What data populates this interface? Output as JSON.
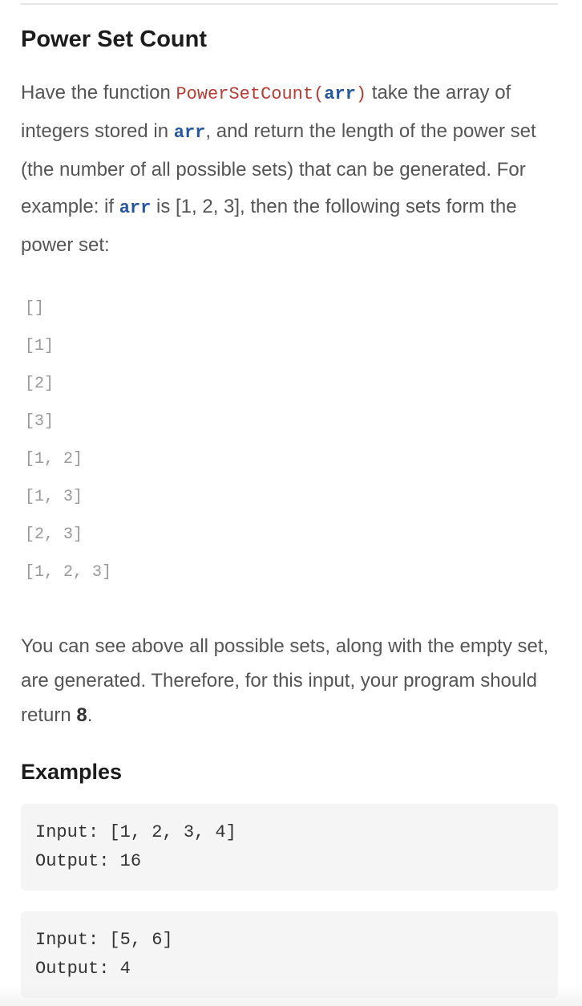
{
  "title": "Power Set Count",
  "intro": {
    "t1": "Have the function ",
    "fn_name": "PowerSetCount(",
    "fn_arg": "arr",
    "fn_close": ")",
    "t2": " take the array of integers stored in ",
    "arr1": "arr",
    "t3": ", and return the length of the power set (the number of all possible sets) that can be generated. For example: if ",
    "arr2": "arr",
    "t4": " is [1, 2, 3], then the following sets form the power set:"
  },
  "sets": [
    "[]",
    "[1]",
    "[2]",
    "[3]",
    "[1, 2]",
    "[1, 3]",
    "[2, 3]",
    "[1, 2, 3]"
  ],
  "outro": {
    "t1": "You can see above all possible sets, along with the empty set, are generated. Therefore, for this input, your program should return ",
    "answer": "8",
    "t2": "."
  },
  "examples_title": "Examples",
  "examples": [
    {
      "input": "Input: [1, 2, 3, 4]",
      "output": "Output: 16"
    },
    {
      "input": "Input: [5, 6]",
      "output": "Output: 4"
    }
  ]
}
